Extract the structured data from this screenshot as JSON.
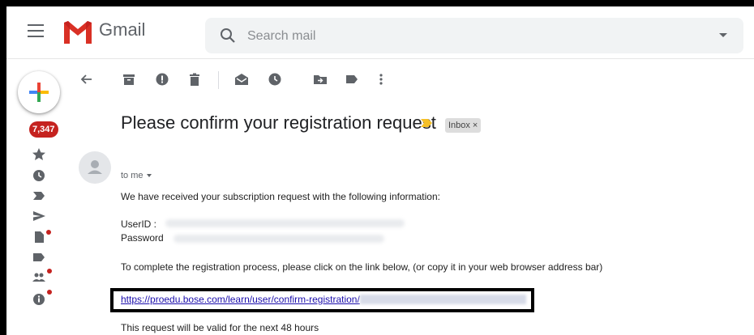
{
  "header": {
    "app_title": "Gmail",
    "search_placeholder": "Search mail"
  },
  "left_rail": {
    "unread_count": "7,347",
    "icons": [
      "compose-icon",
      "inbox-icon",
      "star-icon",
      "clock-icon",
      "important-icon",
      "send-icon",
      "draft-icon",
      "label-icon",
      "people-icon",
      "info-icon"
    ]
  },
  "toolbar": {
    "icons": [
      "back-arrow-icon",
      "archive-icon",
      "report-spam-icon",
      "delete-icon",
      "mark-unread-icon",
      "snooze-icon",
      "move-to-icon",
      "labels-icon",
      "more-icon"
    ]
  },
  "message": {
    "subject": "Please confirm your registration request",
    "label": "Inbox",
    "label_close": "×",
    "to_line": "to me",
    "line1": "We have received your subscription request with the following information:",
    "userid_label": "UserID :",
    "password_label": "Password",
    "instruction": "To complete the registration process, please click on the link below, (or copy it in your web browser address bar)",
    "link": "https://proedu.bose.com/learn/user/confirm-registration/",
    "validity": "This request will be valid for the next 48 hours"
  },
  "colors": {
    "badge": "#c5221f",
    "link": "#1a0dab",
    "important_marker": "#f6c026"
  }
}
